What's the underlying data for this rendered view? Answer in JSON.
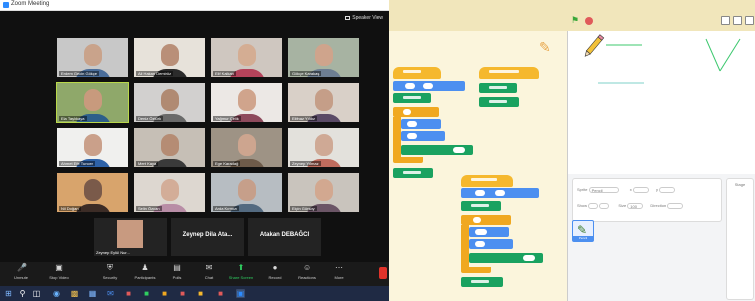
{
  "zoom": {
    "title": "Zoom Meeting",
    "speaker_view": "Speaker View",
    "participants": [
      {
        "name": "Erdem Gecin Gökçe",
        "face": "#c9a38b",
        "bg": "#c8c8c8",
        "body": "#4a6d9a"
      },
      {
        "name": "Ali Hakan Demiröz",
        "face": "#b98f78",
        "bg": "#e7e2da",
        "body": "#2b2b2b"
      },
      {
        "name": "Elif Kalkan",
        "face": "#d4ad93",
        "bg": "#cfc7c0",
        "body": "#b5435b"
      },
      {
        "name": "Gökçe Karakaş",
        "face": "#cfa48c",
        "bg": "#a7b3a2",
        "body": "#6d7e93"
      },
      {
        "name": "Ela Taşlıkaya",
        "face": "#c89a7d",
        "bg": "#8fa86a",
        "body": "#2d5f8a",
        "active": true
      },
      {
        "name": "Deniz Öztürk",
        "face": "#b08a72",
        "bg": "#d2d0cf",
        "body": "#6a6a6a"
      },
      {
        "name": "Yağmur Çelik",
        "face": "#d0a48c",
        "bg": "#ece8e5",
        "body": "#8e4a5c"
      },
      {
        "name": "Elifnaz Yıldız",
        "face": "#c59e88",
        "bg": "#d9d0c8",
        "body": "#5a4a66"
      },
      {
        "name": "Ahmet Efe Tuncer",
        "face": "#caa08a",
        "bg": "#f0f0ee",
        "body": "#2e62a8"
      },
      {
        "name": "Mert Kaya",
        "face": "#b58c74",
        "bg": "#c6bfb6",
        "body": "#3a3a3a"
      },
      {
        "name": "Ege Karadağ",
        "face": "#cda58f",
        "bg": "#9e9385",
        "body": "#6e5b4a"
      },
      {
        "name": "Zeynep Yılmaz",
        "face": "#cfa995",
        "bg": "#e3e1dc",
        "body": "#c06c5e"
      },
      {
        "name": "Nil Doğan",
        "face": "#7a5a4a",
        "bg": "#d8a46c",
        "body": "#3c2c26"
      },
      {
        "name": "Selin Özcan",
        "face": "#d3ad98",
        "bg": "#ddd7d0",
        "body": "#b88da6"
      },
      {
        "name": "Arda Kırmızı",
        "face": "#c69f8a",
        "bg": "#b7bdc2",
        "body": "#536a80"
      },
      {
        "name": "Elçin Gürsoy",
        "face": "#d2a890",
        "bg": "#c9c4bd",
        "body": "#6b5566"
      }
    ],
    "name_tiles": [
      {
        "big": "",
        "name": "Zeynep Eylül Nur..."
      },
      {
        "big": "Zeynep Dila Ata...",
        "name": "Zeynep Dila Ata..."
      },
      {
        "big": "Atakan DEBAĞCI",
        "name": "Atakan DEBAĞCI"
      }
    ],
    "toolbar": {
      "unmute": "Unmute",
      "stop_video": "Stop Video",
      "security": "Security",
      "participants": "Participants",
      "polls": "Polls",
      "chat": "Chat",
      "share_screen": "Share Screen",
      "record": "Record",
      "reactions": "Reactions",
      "more": "More"
    },
    "accent": "#2fce60"
  },
  "scratch": {
    "sprite_name": "Pencil",
    "sprite_label": "Sprite",
    "show_label": "Show",
    "size_label": "Size",
    "direction_label": "Direction",
    "x_label": "x",
    "y_label": "y",
    "size_value": "100",
    "stage_label": "Stage",
    "colors": {
      "events": "#f5b82e",
      "pen": "#1aa260",
      "control": "#f0a820",
      "motion": "#4c8ff0"
    }
  }
}
